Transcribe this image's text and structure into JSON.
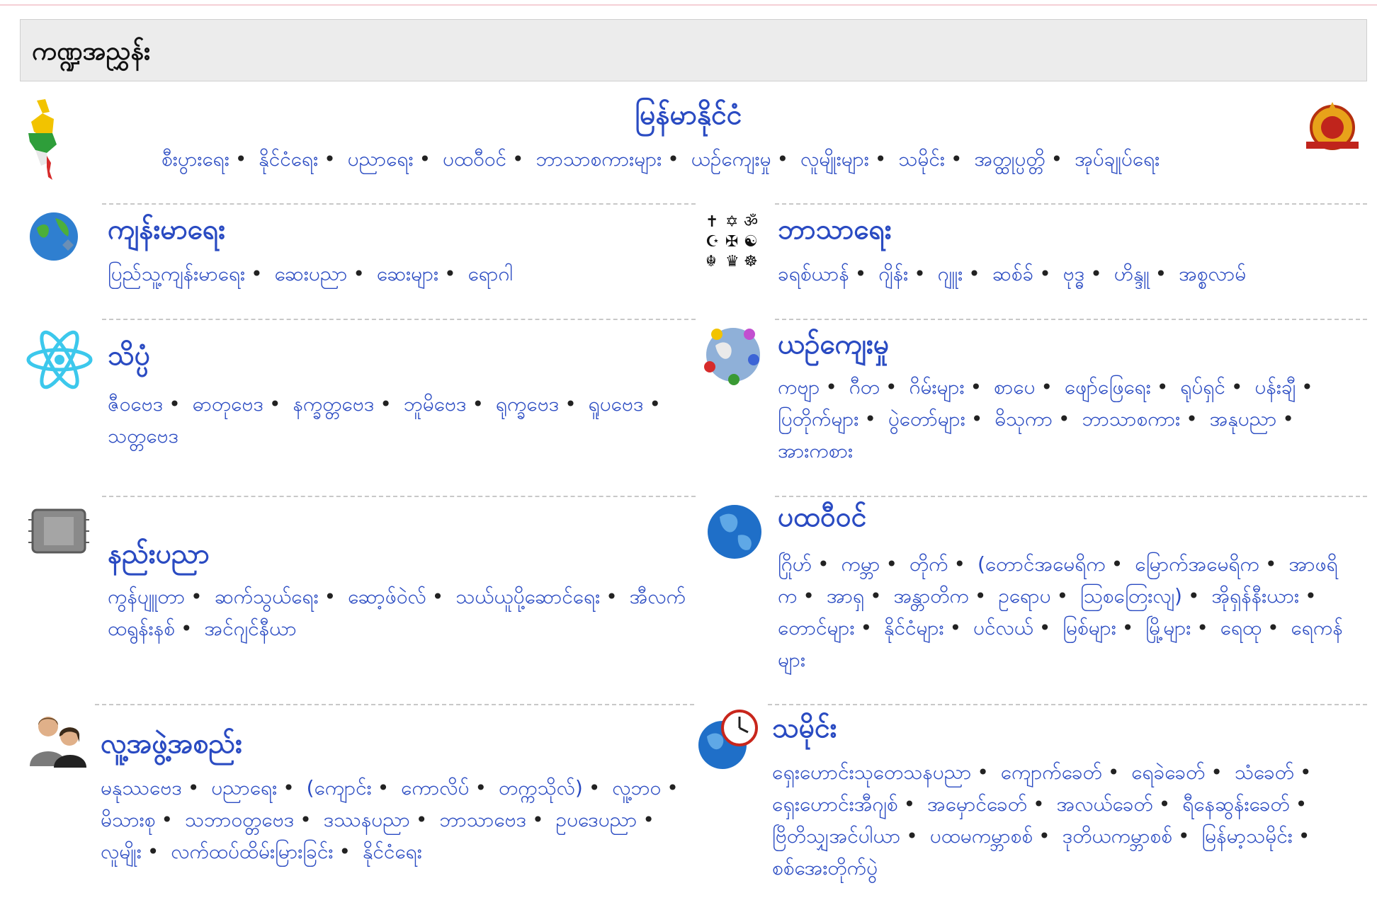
{
  "title": "ကဏ္ဍအညွှန်း",
  "myanmar": {
    "heading": "မြန်မာနိုင်ငံ",
    "links": [
      "စီးပွားရေး",
      "နိုင်ငံရေး",
      "ပညာရေး",
      "ပထဝီဝင်",
      "ဘာသာစကားများ",
      "ယဉ်ကျေးမှု",
      "လူမျိုးများ",
      "သမိုင်း",
      "အတ္ထုပ္ပတ္တိ",
      "အုပ်ချုပ်ရေး"
    ]
  },
  "sections": {
    "health": {
      "heading": "ကျန်းမာရေး",
      "links": [
        "ပြည်သူ့ကျန်းမာရေး",
        "ဆေးပညာ",
        "ဆေးများ",
        "ရောဂါ"
      ]
    },
    "religion": {
      "heading": "ဘာသာရေး",
      "links": [
        "ခရစ်ယာန်",
        "ဂျိန်း",
        "ဂျူး",
        "ဆစ်ခ်",
        "ဗုဒ္ဓ",
        "ဟိန္ဒူ",
        "အစ္စလာမ်"
      ]
    },
    "science": {
      "heading": "သိပ္ပံ",
      "links": [
        "ဇီဝဗေဒ",
        "ဓာတုဗေဒ",
        "နက္ခတ္တဗေဒ",
        "ဘူမိဗေဒ",
        "ရုက္ခဗေဒ",
        "ရူပဗေဒ",
        "သတ္တဗေဒ"
      ]
    },
    "culture": {
      "heading": "ယဉ်ကျေးမှု",
      "links": [
        "ကဗျာ",
        "ဂီတ",
        "ဂိမ်းများ",
        "စာပေ",
        "ဖျော်ဖြေရေး",
        "ရုပ်ရှင်",
        "ပန်းချီ",
        "ပြတိုက်များ",
        "ပွဲတော်များ",
        "ဓိသုကာ",
        "ဘာသာစကား",
        "အနုပညာ",
        "အားကစား"
      ]
    },
    "technology": {
      "heading": "နည်းပညာ",
      "links": [
        "ကွန်ပျူတာ",
        "ဆက်သွယ်ရေး",
        "ဆော့ဖ်ဝဲလ်",
        "သယ်ယူပို့ဆောင်ရေး",
        "အီလက်ထရွန်းနစ်",
        "အင်ဂျင်နီယာ"
      ]
    },
    "geography": {
      "heading": "ပထဝီဝင်",
      "links": [
        "ဂြိုဟ်",
        "ကမ္ဘာ",
        "တိုက်",
        "(တောင်အမေရိက",
        "မြောက်အမေရိက",
        "အာဖရိက",
        "အာရှ",
        "အန္တာတိက",
        "ဥရောပ",
        "ဩစတြေးလျ)",
        "အိုရှန်နီးယား",
        "တောင်များ",
        "နိုင်ငံများ",
        "ပင်လယ်",
        "မြစ်များ",
        "မြို့များ",
        "ရေထု",
        "ရေကန်များ"
      ]
    },
    "society": {
      "heading": "လူ့အဖွဲ့အစည်း",
      "links": [
        "မနုဿဗေဒ",
        "ပညာရေး",
        "(ကျောင်း",
        "ကောလိပ်",
        "တက္ကသိုလ်)",
        "လူ့ဘဝ",
        "မိသားစု",
        "သဘာဝတ္တဗေဒ",
        "ဒဿနပညာ",
        "ဘာသာဗေဒ",
        "ဥပဒေပညာ",
        "လူမျိုး",
        "လက်ထပ်ထိမ်းမြားခြင်း",
        "နိုင်ငံရေး"
      ]
    },
    "history": {
      "heading": "သမိုင်း",
      "links": [
        "ရှေးဟောင်းသုတေသနပညာ",
        "ကျောက်ခေတ်",
        "ရေခဲခေတ်",
        "သံခေတ်",
        "ရှေးဟောင်းအီဂျစ်",
        "အမှောင်ခေတ်",
        "အလယ်ခေတ်",
        "ရီနေဆွန်းခေတ်",
        "ဗြိတိသျှအင်ပါယာ",
        "ပထမကမ္ဘာစစ်",
        "ဒုတိယကမ္ဘာစစ်",
        "မြန်မာ့သမိုင်း",
        "စစ်အေးတိုက်ပွဲ"
      ]
    }
  },
  "icons": {
    "map": "myanmar-map-icon",
    "emblem": "state-seal-icon",
    "health": "globe-medical-icon",
    "religion": "religious-symbols-icon",
    "science": "atom-icon",
    "culture": "culture-globe-icon",
    "technology": "chip-icon",
    "geography": "earth-globe-icon",
    "society": "people-icon",
    "history": "globe-clock-icon"
  },
  "colors": {
    "link": "#2a4bc2",
    "title_bg": "#ececec",
    "dash": "#c8c8c8"
  }
}
